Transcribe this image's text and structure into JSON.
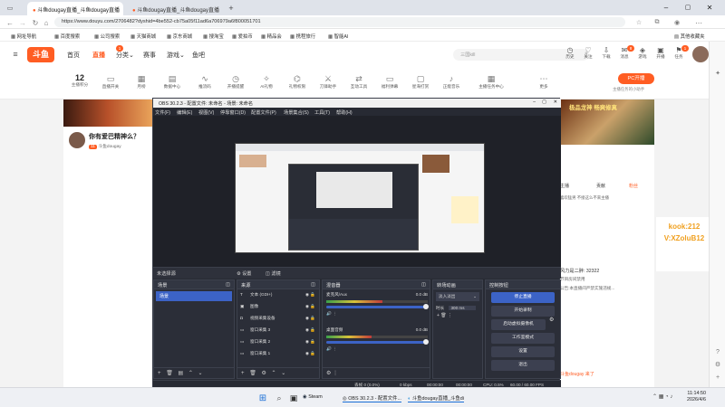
{
  "browser": {
    "tabs": [
      {
        "label": "斗鱼dougay直播_斗鱼dougay直播"
      },
      {
        "label": "斗鱼dougay直播_斗鱼dougay直播"
      }
    ],
    "url": "https://www.douyu.com/2706482?dyshid=4be552-cb75a05f11ad6a706979a6f800051701",
    "bookmarks": [
      "网址导航",
      "百度搜索",
      "公司搜索",
      "天猫商城",
      "京东商城",
      "搜淘宝",
      "爱拍币",
      "精品会",
      "携程旅行",
      "智能AI"
    ],
    "other_bookmarks": "其他收藏夹"
  },
  "douyu": {
    "logo": "斗鱼",
    "nav": [
      "首页",
      "直播",
      "分类",
      "赛事",
      "游戏",
      "鱼吧"
    ],
    "nav_badge": "1",
    "search_placeholder": "三国kill",
    "top_icons": [
      "历史",
      "关注",
      "下载",
      "消息",
      "游戏",
      "开播",
      "任务"
    ],
    "msg_badge": "8",
    "task_badge": "1",
    "stats": {
      "level": "12",
      "level_label": "主播积分"
    },
    "toolbar": [
      "直播开关",
      "月榜",
      "数据中心",
      "推流码",
      "开播提醒",
      "AI礼物",
      "礼物权限",
      "刀锋助手",
      "互动工具",
      "福利弹幕",
      "星海打赏",
      "正能音乐",
      "主播任务中心",
      "更多"
    ],
    "pc_btn": "PC开播",
    "pc_sub": "主播任务的小助手",
    "streamer_title": "你有爱巴精神么？",
    "streamer_name": "斗鱼dougay",
    "game_banner": "极品龙神 畅爽修真",
    "right_tabs": [
      "主播",
      "贡献",
      "粉丝"
    ],
    "right_notice": "喜欢猛男 不接这么不来主播",
    "chat_lines": [
      "风力是二胖: 32322",
      "节目房间禁用",
      "公告:本直播间严禁实施违规...",
      "斗鱼dougay 来了"
    ],
    "ad_text": "kook:212 V:XZoluB12"
  },
  "obs": {
    "title": "OBS 30.2.3 - 配置文件: 未命名 - 场景: 未命名",
    "menu": [
      "文件(F)",
      "编辑(E)",
      "视图(V)",
      "停靠窗口(D)",
      "配置文件(P)",
      "场景集合(S)",
      "工具(T)",
      "帮助(H)"
    ],
    "scene_label": "未选择源",
    "scene_buttons": [
      "设置",
      "滤镜"
    ],
    "docks": {
      "scenes": {
        "title": "场景",
        "items": [
          "场景"
        ]
      },
      "sources": {
        "title": "来源",
        "items": [
          "文本 (GDI+)",
          "图像",
          "视频采集设备",
          "窗口采集 3",
          "窗口采集 2",
          "窗口采集 1"
        ]
      },
      "mixer": {
        "title": "混音器",
        "ch1": "麦克风/Aux",
        "ch1_db": "0.0 dB",
        "ch2": "桌面音频",
        "ch2_db": "0.0 dB",
        "ch1_level": 0.55,
        "ch2_level": 0.45
      },
      "transitions": {
        "title": "转场动画",
        "type": "淡入淡出",
        "dur_label": "时长",
        "dur_value": "300 ms"
      },
      "controls": {
        "title": "控制按钮",
        "buttons": [
          "停止直播",
          "开始录制",
          "启动虚拟摄像机",
          "工作室模式",
          "设置",
          "退出"
        ]
      }
    },
    "status": {
      "scenes_note": "丢帧 0 (0.0%)",
      "kbps": "0 kbps",
      "t1": "00:00:00",
      "t2": "00:00:00",
      "cpu": "CPU: 0.5%",
      "fps": "60.00 / 60.00 FPS"
    }
  },
  "taskbar": {
    "items": [
      "Steam",
      "OBS 30.2.3 - 配置文件...",
      "斗鱼dougay直播_斗鱼di"
    ],
    "time": "11:14:50",
    "date": "2026/4/6"
  },
  "colors": {
    "douyu_orange": "#ff5d23",
    "obs_bg": "#272a33",
    "obs_blue": "#3c63c6"
  }
}
